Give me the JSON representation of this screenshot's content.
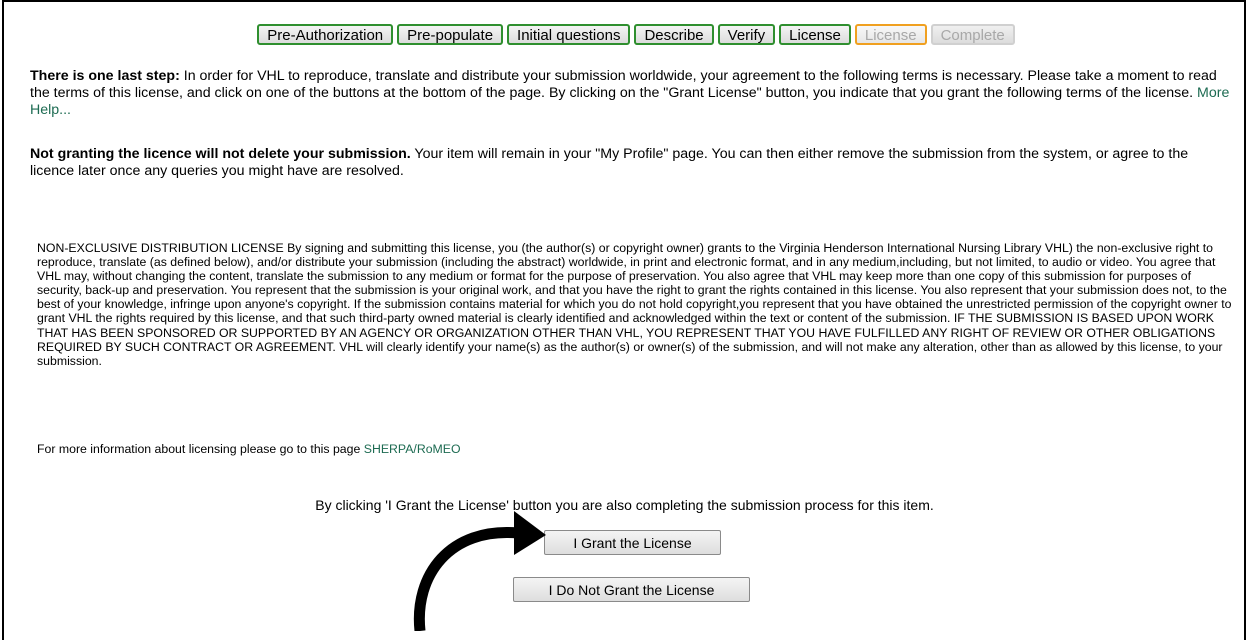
{
  "steps": [
    {
      "label": "Pre-Authorization",
      "state": "done"
    },
    {
      "label": "Pre-populate",
      "state": "done"
    },
    {
      "label": "Initial questions",
      "state": "done"
    },
    {
      "label": "Describe",
      "state": "done"
    },
    {
      "label": "Verify",
      "state": "done"
    },
    {
      "label": "License",
      "state": "done"
    },
    {
      "label": "License",
      "state": "current"
    },
    {
      "label": "Complete",
      "state": "disabled"
    }
  ],
  "intro": {
    "bold": "There is one last step:",
    "text": " In order for VHL to reproduce, translate and distribute your submission worldwide, your agreement to the following terms is necessary. Please take a moment to read the terms of this license, and click on one of the buttons at the bottom of the page. By clicking on the \"Grant License\" button, you indicate that you grant the following terms of the license. ",
    "help_link": "More Help..."
  },
  "notice": {
    "bold": "Not granting the licence will not delete your submission.",
    "text": " Your item will remain in your \"My Profile\" page. You can then either remove the submission from the system, or agree to the licence later once any queries you might have are resolved."
  },
  "license_text": "NON-EXCLUSIVE DISTRIBUTION LICENSE By signing and submitting this license, you (the author(s) or copyright owner) grants to the Virginia Henderson International Nursing Library VHL) the non-exclusive right to reproduce, translate (as defined below), and/or distribute your submission (including the abstract) worldwide, in print and electronic format, and in any medium,including, but not limited, to audio or video. You agree that VHL may, without changing the content, translate the submission to any medium or format for the purpose of preservation. You also agree that VHL may keep more than one copy of this submission for purposes of security, back-up and preservation. You represent that the submission is your original work, and that you have the right to grant the rights contained in this license. You also represent that your submission does not, to the best of your knowledge, infringe upon anyone's copyright. If the submission contains material for which you do not hold copyright,you represent that you have obtained the unrestricted permission of the copyright owner to grant VHL the rights required by this license, and that such third-party owned material is clearly identified and acknowledged within the text or content of the submission. IF THE SUBMISSION IS BASED UPON WORK THAT HAS BEEN SPONSORED OR SUPPORTED BY AN AGENCY OR ORGANIZATION OTHER THAN VHL, YOU REPRESENT THAT YOU HAVE FULFILLED ANY RIGHT OF REVIEW OR OTHER OBLIGATIONS REQUIRED BY SUCH CONTRACT OR AGREEMENT. VHL will clearly identify your name(s) as the author(s) or owner(s) of the submission, and will not make any alteration, other than as allowed by this license, to your submission.",
  "more_info": {
    "text": "For more information about licensing please go to this page ",
    "link": "SHERPA/RoMEO"
  },
  "grant_note": "By clicking 'I Grant the License' button you are also completing the submission process for this item.",
  "buttons": {
    "grant": "I Grant the License",
    "no_grant": "I Do Not Grant the License"
  },
  "colors": {
    "step_border_done": "#2f8f2f",
    "step_border_current": "#f0a020",
    "link": "#1d6b52"
  },
  "icons": {
    "annotation": "curved-arrow-icon"
  }
}
